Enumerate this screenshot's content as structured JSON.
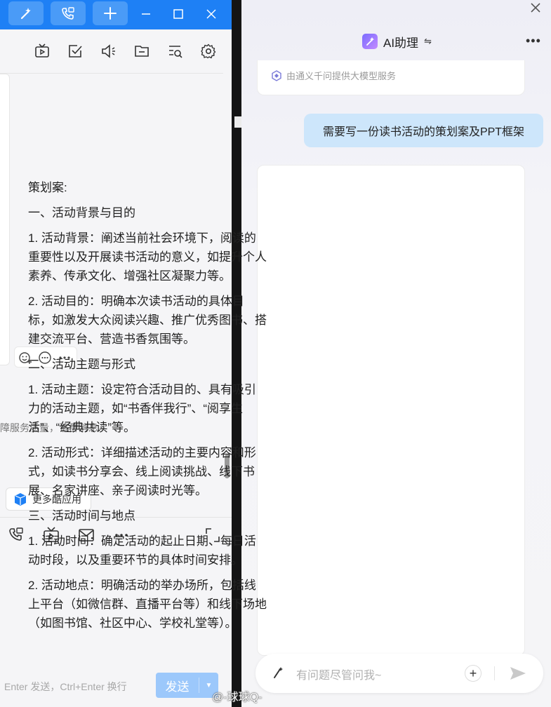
{
  "left_window": {
    "notice_text": "障服务质量，该群消息",
    "more_apps_label": "更多酷应用",
    "input_hint": "Enter 发送，Ctrl+Enter 换行",
    "send_label": "发送"
  },
  "ai_panel": {
    "title": "AI助理",
    "provider": "由通义千问提供大模型服务",
    "user_message": "需要写一份读书活动的策划案及PPT框架",
    "answer_paragraphs": [
      "策划案:",
      "一、活动背景与目的",
      "1. 活动背景：阐述当前社会环境下，阅读的重要性以及开展读书活动的意义，如提升个人素养、传承文化、增强社区凝聚力等。",
      "2. 活动目的：明确本次读书活动的具体目标，如激发大众阅读兴趣、推广优秀图书、搭建交流平台、营造书香氛围等。",
      "二、活动主题与形式",
      "1. 活动主题：设定符合活动目的、具有吸引力的活动主题，如“书香伴我行”、“阅享生活”、“经典共读”等。",
      "2. 活动形式：详细描述活动的主要内容和形式，如读书分享会、线上阅读挑战、线下书展、名家讲座、亲子阅读时光等。",
      "三、活动时间与地点",
      "1. 活动时间：确定活动的起止日期、每日活动时段，以及重要环节的具体时间安排。",
      "2. 活动地点：明确活动的举办场所，包括线上平台（如微信群、直播平台等）和线下场地（如图书馆、社区中心、学校礼堂等）。"
    ],
    "input_placeholder": "有问题尽管问我~",
    "watermark": "@-球球Q-"
  },
  "colors": {
    "titlebar": "#1e80f5",
    "user_bubble": "#cde6fb",
    "send_button": "#9cc8fb"
  }
}
